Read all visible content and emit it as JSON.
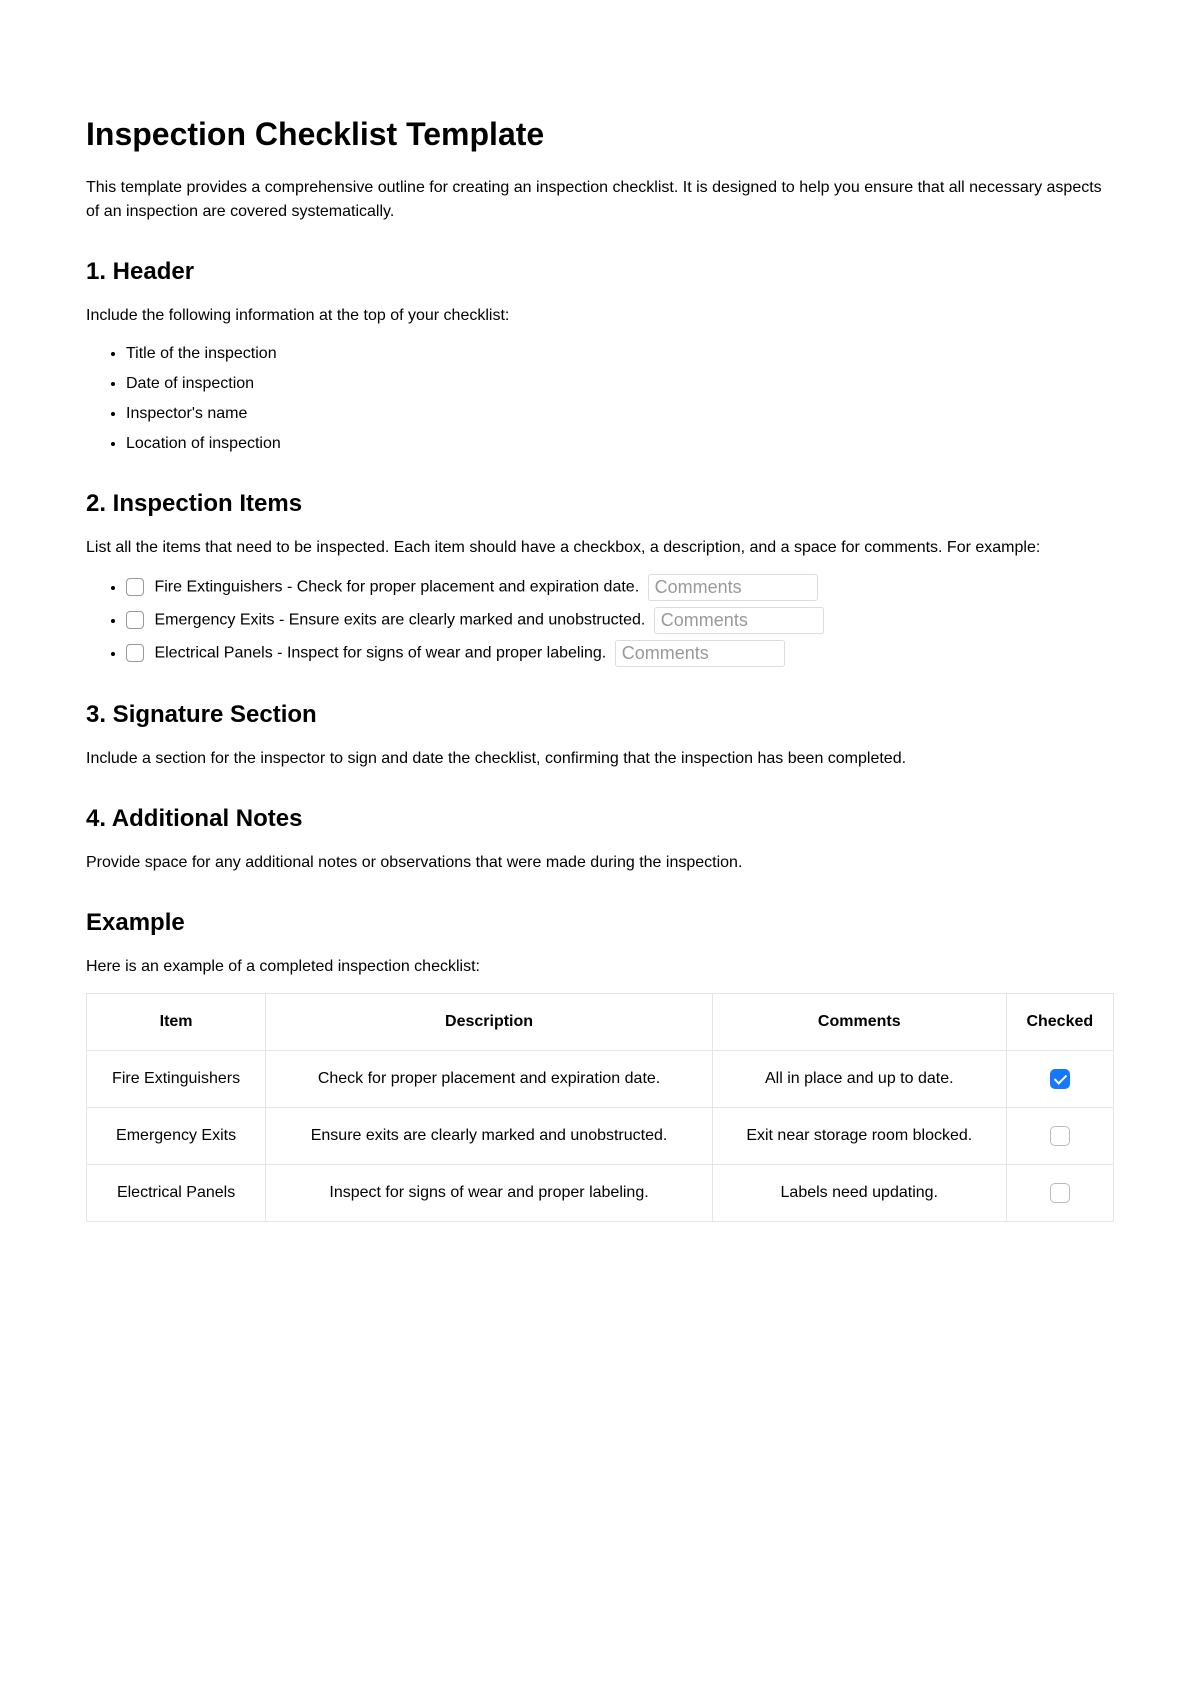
{
  "title": "Inspection Checklist Template",
  "intro": "This template provides a comprehensive outline for creating an inspection checklist. It is designed to help you ensure that all necessary aspects of an inspection are covered systematically.",
  "sections": {
    "header": {
      "heading": "1. Header",
      "text": "Include the following information at the top of your checklist:",
      "bullets": [
        "Title of the inspection",
        "Date of inspection",
        "Inspector's name",
        "Location of inspection"
      ]
    },
    "items": {
      "heading": "2. Inspection Items",
      "text": "List all the items that need to be inspected. Each item should have a checkbox, a description, and a space for comments. For example:",
      "list": [
        {
          "label": "Fire Extinguishers - Check for proper placement and expiration date.",
          "placeholder": "Comments"
        },
        {
          "label": "Emergency Exits - Ensure exits are clearly marked and unobstructed.",
          "placeholder": "Comments"
        },
        {
          "label": "Electrical Panels - Inspect for signs of wear and proper labeling.",
          "placeholder": "Comments"
        }
      ]
    },
    "signature": {
      "heading": "3. Signature Section",
      "text": "Include a section for the inspector to sign and date the checklist, confirming that the inspection has been completed."
    },
    "notes": {
      "heading": "4. Additional Notes",
      "text": "Provide space for any additional notes or observations that were made during the inspection."
    },
    "example": {
      "heading": "Example",
      "text": "Here is an example of a completed inspection checklist:",
      "columns": [
        "Item",
        "Description",
        "Comments",
        "Checked"
      ],
      "rows": [
        {
          "item": "Fire Extinguishers",
          "desc": "Check for proper placement and expiration date.",
          "comments": "All in place and up to date.",
          "checked": true
        },
        {
          "item": "Emergency Exits",
          "desc": "Ensure exits are clearly marked and unobstructed.",
          "comments": "Exit near storage room blocked.",
          "checked": false
        },
        {
          "item": "Electrical Panels",
          "desc": "Inspect for signs of wear and proper labeling.",
          "comments": "Labels need updating.",
          "checked": false
        }
      ]
    }
  }
}
